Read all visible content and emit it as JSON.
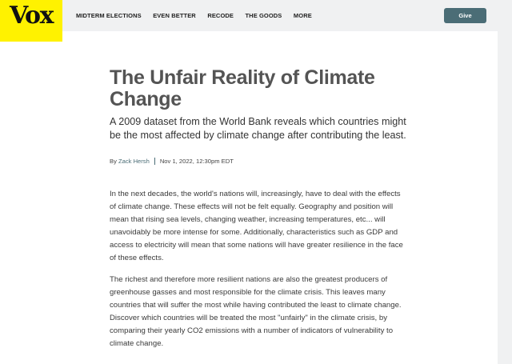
{
  "header": {
    "logo_text": "Vox",
    "nav_items": [
      "MIDTERM ELECTIONS",
      "EVEN BETTER",
      "RECODE",
      "THE GOODS",
      "MORE"
    ],
    "give_label": "Give"
  },
  "article": {
    "title": "The Unfair Reality of Climate Change",
    "subtitle": "A 2009 dataset from the World Bank reveals which countries might be the most affected by climate change after contributing the least.",
    "byline": {
      "prefix": "By",
      "author": "Zack Hersh",
      "date": "Nov 1, 2022, 12:30pm EDT"
    },
    "paragraphs": [
      "In the next decades, the world's nations will, increasingly, have to deal with the effects of climate change. These effects will not be felt equally. Geography and position will mean that rising sea levels, changing weather, increasing temperatures, etc... will unavoidably be more intense for some. Additionally, characteristics such as GDP and access to electricity will mean that some nations will have greater resilience in the face of these effects.",
      "The richest and therefore more resilient nations are also the greatest producers of greenhouse gasses and most responsible for the climate crisis. This leaves many countries that will suffer the most while having contributed the least to climate change. Discover which countries will be treated the most \"unfairly\" in the climate crisis, by comparing their yearly CO2 emissions with a number of indicators of vulnerability to climate change."
    ]
  },
  "colors": {
    "logo_bg": "#fff200",
    "header_bg": "#f0f1f2",
    "accent": "#4b6d76",
    "title": "#545454"
  }
}
